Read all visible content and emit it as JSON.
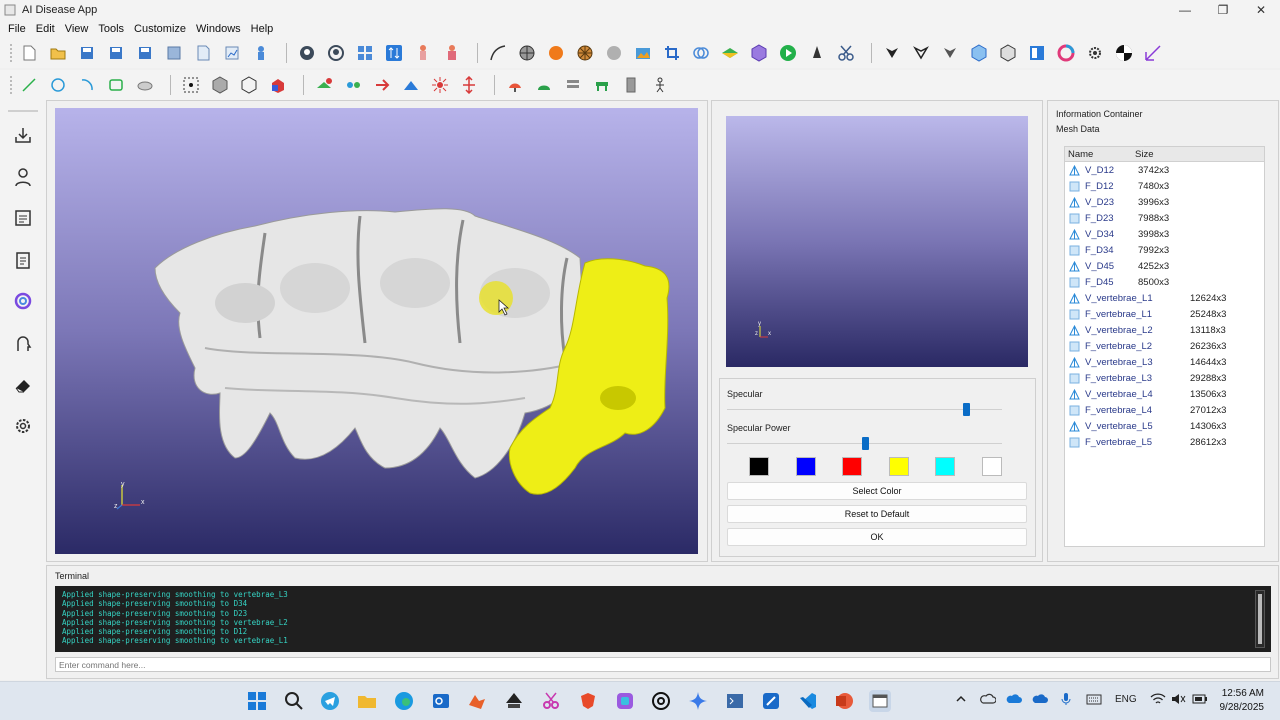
{
  "window": {
    "title": "AI Disease App",
    "controls": [
      "—",
      "❐",
      "✕"
    ]
  },
  "menu": [
    "File",
    "Edit",
    "View",
    "Tools",
    "Customize",
    "Windows",
    "Help"
  ],
  "viewport": {
    "axes": {
      "x": "x",
      "y": "y",
      "z": "z"
    }
  },
  "preview": {
    "axes": {
      "x": "x",
      "y": "y",
      "z": "z"
    }
  },
  "properties": {
    "specular_label": "Specular",
    "specular_value": 0.87,
    "specular_power_label": "Specular Power",
    "specular_power_value": 0.5,
    "swatch_colors": [
      "#000000",
      "#0000ff",
      "#ff0000",
      "#ffff00",
      "#00ffff",
      "#ffffff"
    ],
    "select_color_label": "Select Color",
    "reset_label": "Reset to Default",
    "ok_label": "OK"
  },
  "info": {
    "title": "Information Container",
    "mesh_title": "Mesh Data",
    "columns": [
      "Name",
      "Size"
    ],
    "rows": [
      {
        "type": "vertex",
        "name": "V_D12",
        "size": "3742x3"
      },
      {
        "type": "face",
        "name": "F_D12",
        "size": "7480x3"
      },
      {
        "type": "vertex",
        "name": "V_D23",
        "size": "3996x3"
      },
      {
        "type": "face",
        "name": "F_D23",
        "size": "7988x3"
      },
      {
        "type": "vertex",
        "name": "V_D34",
        "size": "3998x3"
      },
      {
        "type": "face",
        "name": "F_D34",
        "size": "7992x3"
      },
      {
        "type": "vertex",
        "name": "V_D45",
        "size": "4252x3"
      },
      {
        "type": "face",
        "name": "F_D45",
        "size": "8500x3"
      },
      {
        "type": "vertex",
        "name": "V_vertebrae_L1",
        "size": "12624x3"
      },
      {
        "type": "face",
        "name": "F_vertebrae_L1",
        "size": "25248x3"
      },
      {
        "type": "vertex",
        "name": "V_vertebrae_L2",
        "size": "13118x3"
      },
      {
        "type": "face",
        "name": "F_vertebrae_L2",
        "size": "26236x3"
      },
      {
        "type": "vertex",
        "name": "V_vertebrae_L3",
        "size": "14644x3"
      },
      {
        "type": "face",
        "name": "F_vertebrae_L3",
        "size": "29288x3"
      },
      {
        "type": "vertex",
        "name": "V_vertebrae_L4",
        "size": "13506x3"
      },
      {
        "type": "face",
        "name": "F_vertebrae_L4",
        "size": "27012x3"
      },
      {
        "type": "vertex",
        "name": "V_vertebrae_L5",
        "size": "14306x3"
      },
      {
        "type": "face",
        "name": "F_vertebrae_L5",
        "size": "28612x3"
      }
    ]
  },
  "terminal": {
    "title": "Terminal",
    "lines": [
      "Applied shape-preserving smoothing to vertebrae_L3",
      "Applied shape-preserving smoothing to D34",
      "Applied shape-preserving smoothing to D23",
      "Applied shape-preserving smoothing to vertebrae_L2",
      "Applied shape-preserving smoothing to D12",
      "Applied shape-preserving smoothing to vertebrae_L1"
    ],
    "command_placeholder": "Enter command here..."
  },
  "taskbar": {
    "language": "ENG",
    "time": "12:56 AM",
    "date": "9/28/2025"
  }
}
